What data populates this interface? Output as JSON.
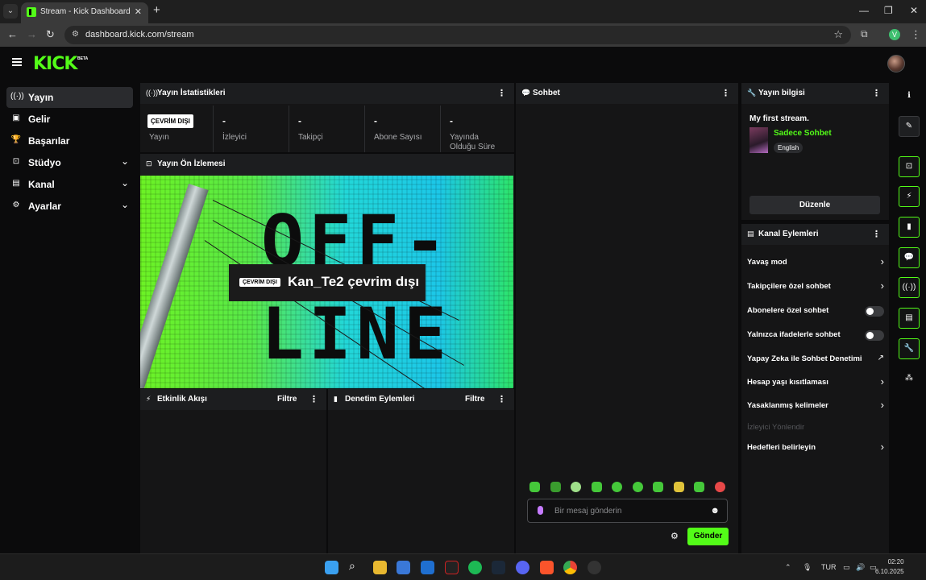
{
  "browser": {
    "tab_title": "Stream - Kick Dashboard",
    "url": "dashboard.kick.com/stream",
    "profile_initial": "V"
  },
  "brand": {
    "logo": "KICK",
    "badge": "BETA",
    "accent": "#53fc18"
  },
  "sidebar": {
    "items": [
      {
        "label": "Yayın",
        "icon": "broadcast-icon",
        "active": true
      },
      {
        "label": "Gelir",
        "icon": "revenue-icon"
      },
      {
        "label": "Başarılar",
        "icon": "trophy-icon"
      },
      {
        "label": "Stüdyo",
        "icon": "studio-icon",
        "expandable": true
      },
      {
        "label": "Kanal",
        "icon": "channel-icon",
        "expandable": true
      },
      {
        "label": "Ayarlar",
        "icon": "gear-icon",
        "expandable": true
      }
    ]
  },
  "stats": {
    "title": "Yayın İstatistikleri",
    "status_badge": "ÇEVRİM DIŞI",
    "status_label": "Yayın",
    "cells": [
      {
        "value": "-",
        "label": "İzleyici"
      },
      {
        "value": "-",
        "label": "Takipçi"
      },
      {
        "value": "-",
        "label": "Abone Sayısı"
      },
      {
        "value": "-",
        "label": "Yayında Olduğu Süre"
      }
    ]
  },
  "preview": {
    "title": "Yayın Ön İzlemesi",
    "badge": "ÇEVRİM DIŞI",
    "offline_text": "Kan_Te2 çevrim dışı",
    "art_line1": "OFF-",
    "art_line2": "LINE"
  },
  "activity": {
    "title": "Etkinlik Akışı",
    "filter": "Filtre"
  },
  "moderation": {
    "title": "Denetim Eylemleri",
    "filter": "Filtre"
  },
  "chat": {
    "title": "Sohbet",
    "placeholder": "Bir mesaj gönderin",
    "send": "Gönder"
  },
  "stream_info": {
    "title": "Yayın bilgisi",
    "stream_title": "My first stream.",
    "category": "Sadece Sohbet",
    "language": "English",
    "edit": "Düzenle"
  },
  "channel_actions": {
    "title": "Kanal Eylemleri",
    "rows": [
      {
        "label": "Yavaş mod",
        "control": "arrow"
      },
      {
        "label": "Takipçilere özel sohbet",
        "control": "arrow"
      },
      {
        "label": "Abonelere özel sohbet",
        "control": "toggle",
        "on": false
      },
      {
        "label": "Yalnızca ifadelerle sohbet",
        "control": "toggle",
        "on": false
      },
      {
        "label": "Yapay Zeka ile Sohbet Denetimi",
        "control": "external"
      },
      {
        "label": "Hesap yaşı kısıtlaması",
        "control": "arrow"
      },
      {
        "label": "Yasaklanmış kelimeler",
        "control": "arrow"
      },
      {
        "label": "İzleyici Yönlendir",
        "control": "none",
        "disabled": true
      },
      {
        "label": "Hedefleri belirleyin",
        "control": "arrow"
      }
    ]
  },
  "taskbar": {
    "language": "TUR",
    "time": "02:20",
    "date": "6.10.2025"
  }
}
